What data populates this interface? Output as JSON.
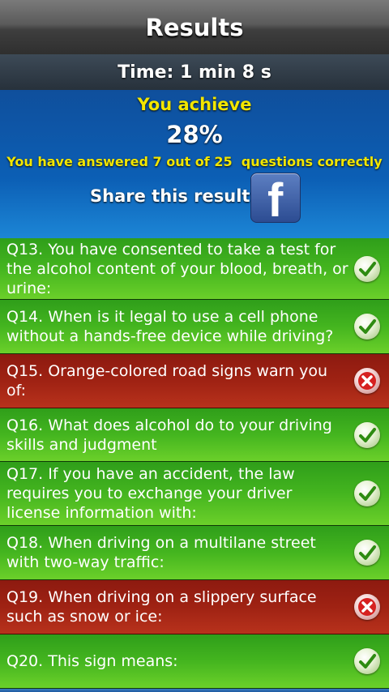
{
  "header": {
    "title": "Results"
  },
  "time": {
    "text": "Time: 1 min 8 s"
  },
  "summary": {
    "achieve_label": "You achieve",
    "percent": "28%",
    "answered_text": "You have answered 7 out of 25  questions correctly",
    "share_label": "Share this result",
    "share_icon": "facebook-icon"
  },
  "colors": {
    "correct": "#44b51f",
    "wrong": "#9f2213",
    "summary_bg": "#0c5fb5",
    "highlight_text": "#f2e600"
  },
  "questions": [
    {
      "text": "Q13. You have consented to take a test for the alcohol content of your blood, breath, or urine:",
      "status": "correct",
      "icon": "check-icon"
    },
    {
      "text": "Q14. When is it legal to use a cell phone without a hands-free device while driving?",
      "status": "correct",
      "icon": "check-icon"
    },
    {
      "text": "Q15. Orange-colored road signs warn you of:",
      "status": "wrong",
      "icon": "cross-icon"
    },
    {
      "text": "Q16. What does alcohol do to your driving skills and judgment",
      "status": "correct",
      "icon": "check-icon"
    },
    {
      "text": "Q17. If you have an accident, the law requires you to exchange your driver license information with:",
      "status": "correct",
      "icon": "check-icon"
    },
    {
      "text": "Q18. When driving on a multilane street with two-way traffic:",
      "status": "correct",
      "icon": "check-icon"
    },
    {
      "text": "Q19. When driving on a slippery surface such as snow or ice:",
      "status": "wrong",
      "icon": "cross-icon"
    },
    {
      "text": "Q20. This sign means:",
      "status": "correct",
      "icon": "check-icon"
    }
  ]
}
